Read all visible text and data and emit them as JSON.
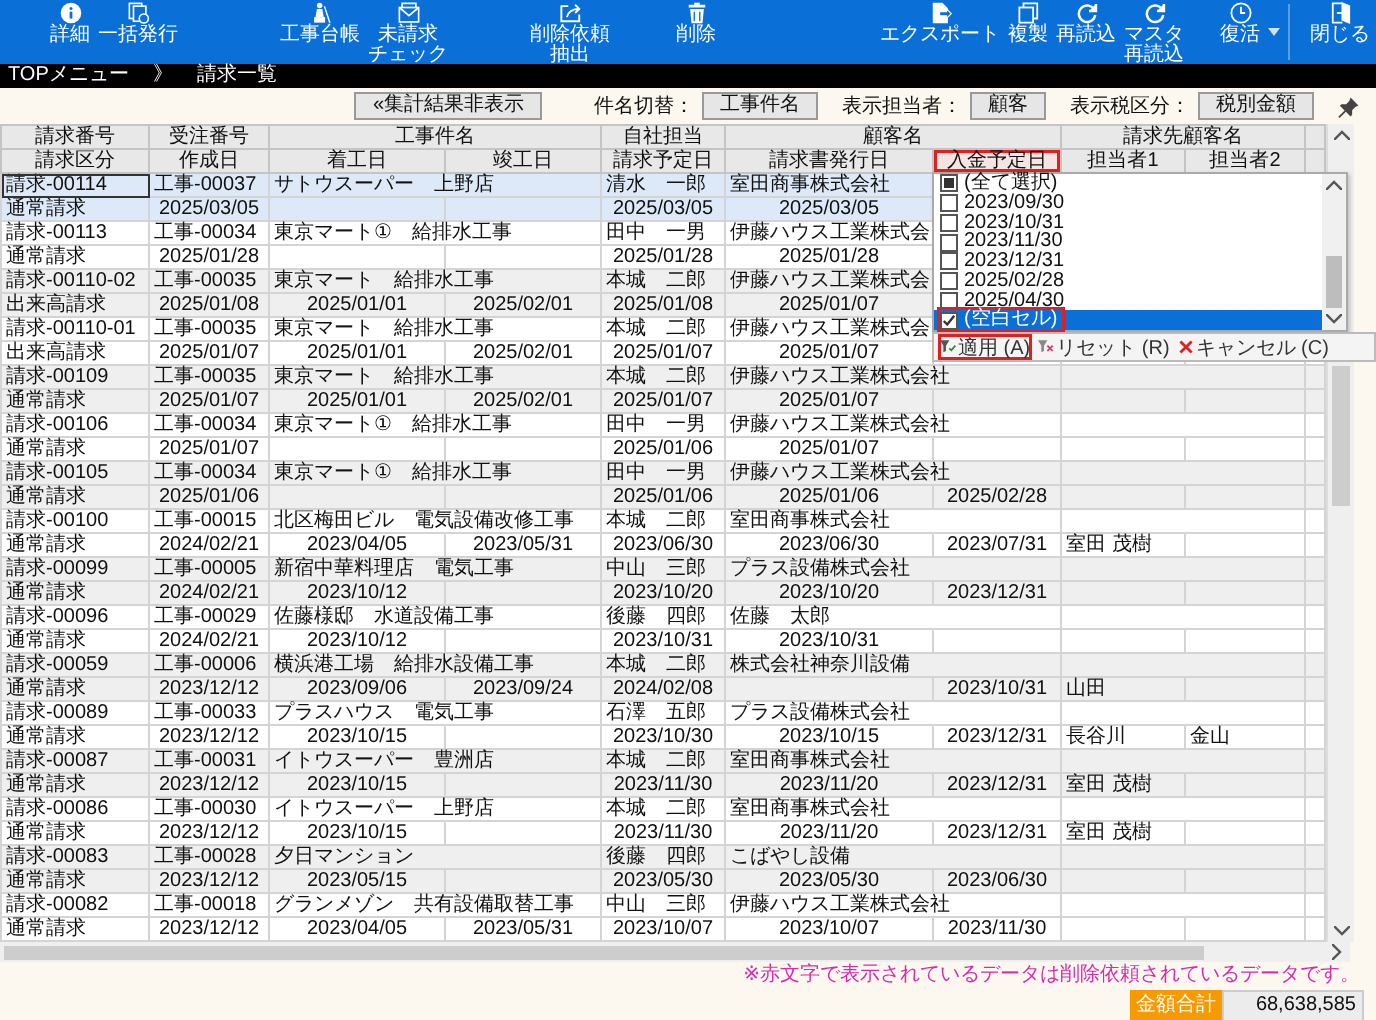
{
  "toolbar": [
    "詳細",
    "一括発行",
    "工事台帳",
    "未請求チェック",
    "削除依頼抽出",
    "削除",
    "エクスポート",
    "複製",
    "再読込",
    "マスタ再読込",
    "復活",
    "閉じる"
  ],
  "breadcrumb": {
    "parent": "TOPメニュー",
    "separator": "》",
    "current": "請求一覧"
  },
  "filter_bar": {
    "toggle_button": "«集計結果非表示",
    "switches": [
      {
        "label": "件名切替：",
        "value": "工事件名"
      },
      {
        "label": "表示担当者：",
        "value": "顧客"
      },
      {
        "label": "表示税区分：",
        "value": "税別金額"
      }
    ]
  },
  "table": {
    "header_top": [
      "請求番号",
      "受注番号",
      "工事件名",
      "自社担当",
      "顧客名",
      "請求先顧客名"
    ],
    "header_bottom": [
      {
        "label": "請求区分",
        "highlighted": false
      },
      {
        "label": "作成日",
        "highlighted": false
      },
      {
        "label": "着工日",
        "highlighted": false
      },
      {
        "label": "竣工日",
        "highlighted": false
      },
      {
        "label": "請求予定日",
        "highlighted": false
      },
      {
        "label": "請求書発行日",
        "highlighted": false
      },
      {
        "label": "入金予定日",
        "highlighted": true
      },
      {
        "label": "担当者1",
        "highlighted": false
      },
      {
        "label": "担当者2",
        "highlighted": false
      }
    ],
    "records": [
      {
        "invoice_no": "請求-00114",
        "order_no": "工事-00037",
        "project": "サトウスーパー　上野店",
        "staff": "清水　一郎",
        "customer": "室田商事株式会社",
        "invoice_type": "通常請求",
        "created": "2025/03/05",
        "bill_date": "2025/03/05",
        "issue_date": "2025/03/05",
        "selected": true
      },
      {
        "invoice_no": "請求-00113",
        "order_no": "工事-00034",
        "project": "東京マート①　給排水工事",
        "staff": "田中　一男",
        "customer": "伊藤ハウス工業株式会",
        "invoice_type": "通常請求",
        "created": "2025/01/28",
        "bill_date": "2025/01/28",
        "issue_date": "2025/01/28",
        "selected": false
      },
      {
        "invoice_no": "請求-00110-02",
        "order_no": "工事-00035",
        "project": "東京マート　給排水工事",
        "staff": "本城　二郎",
        "customer": "伊藤ハウス工業株式会",
        "invoice_type": "出来高請求",
        "created": "2025/01/08",
        "start": "2025/01/01",
        "end": "2025/02/01",
        "bill_date": "2025/01/08",
        "issue_date": "2025/01/07",
        "selected": false
      },
      {
        "invoice_no": "請求-00110-01",
        "order_no": "工事-00035",
        "project": "東京マート　給排水工事",
        "staff": "本城　二郎",
        "customer": "伊藤ハウス工業株式会",
        "invoice_type": "出来高請求",
        "created": "2025/01/07",
        "start": "2025/01/01",
        "end": "2025/02/01",
        "bill_date": "2025/01/07",
        "issue_date": "2025/01/07",
        "selected": false
      },
      {
        "invoice_no": "請求-00109",
        "order_no": "工事-00035",
        "project": "東京マート　給排水工事",
        "staff": "本城　二郎",
        "customer": "伊藤ハウス工業株式会社",
        "invoice_type": "通常請求",
        "created": "2025/01/07",
        "start": "2025/01/01",
        "end": "2025/02/01",
        "bill_date": "2025/01/07",
        "issue_date": "2025/01/07",
        "selected": false
      },
      {
        "invoice_no": "請求-00106",
        "order_no": "工事-00034",
        "project": "東京マート①　給排水工事",
        "staff": "田中　一男",
        "customer": "伊藤ハウス工業株式会社",
        "invoice_type": "通常請求",
        "created": "2025/01/07",
        "bill_date": "2025/01/06",
        "issue_date": "2025/01/07",
        "selected": false
      },
      {
        "invoice_no": "請求-00105",
        "order_no": "工事-00034",
        "project": "東京マート①　給排水工事",
        "staff": "田中　一男",
        "customer": "伊藤ハウス工業株式会社",
        "invoice_type": "通常請求",
        "created": "2025/01/06",
        "bill_date": "2025/01/06",
        "issue_date": "2025/01/06",
        "pay_date": "2025/02/28",
        "selected": false
      },
      {
        "invoice_no": "請求-00100",
        "order_no": "工事-00015",
        "project": "北区梅田ビル　電気設備改修工事",
        "staff": "本城　二郎",
        "customer": "室田商事株式会社",
        "invoice_type": "通常請求",
        "created": "2024/02/21",
        "start": "2023/04/05",
        "end": "2023/05/31",
        "bill_date": "2023/06/30",
        "issue_date": "2023/06/30",
        "pay_date": "2023/07/31",
        "person1": "室田 茂樹",
        "selected": false
      },
      {
        "invoice_no": "請求-00099",
        "order_no": "工事-00005",
        "project": "新宿中華料理店　電気工事",
        "staff": "中山　三郎",
        "customer": "プラス設備株式会社",
        "invoice_type": "通常請求",
        "created": "2024/02/21",
        "start": "2023/10/12",
        "bill_date": "2023/10/20",
        "issue_date": "2023/10/20",
        "pay_date": "2023/12/31",
        "selected": false
      },
      {
        "invoice_no": "請求-00096",
        "order_no": "工事-00029",
        "project": "佐藤様邸　水道設備工事",
        "staff": "後藤　四郎",
        "customer": "佐藤　太郎",
        "invoice_type": "通常請求",
        "created": "2024/02/21",
        "start": "2023/10/12",
        "bill_date": "2023/10/31",
        "issue_date": "2023/10/31",
        "selected": false
      },
      {
        "invoice_no": "請求-00059",
        "order_no": "工事-00006",
        "project": "横浜港工場　給排水設備工事",
        "staff": "本城　二郎",
        "customer": "株式会社神奈川設備",
        "invoice_type": "通常請求",
        "created": "2023/12/12",
        "start": "2023/09/06",
        "end": "2023/09/24",
        "bill_date": "2024/02/08",
        "pay_date": "2023/10/31",
        "person1": "山田",
        "selected": false
      },
      {
        "invoice_no": "請求-00089",
        "order_no": "工事-00033",
        "project": "プラスハウス　電気工事",
        "staff": "石澤　五郎",
        "customer": "プラス設備株式会社",
        "invoice_type": "通常請求",
        "created": "2023/12/12",
        "start": "2023/10/15",
        "bill_date": "2023/10/30",
        "issue_date": "2023/10/15",
        "pay_date": "2023/12/31",
        "person1": "長谷川",
        "person2": "金山",
        "selected": false
      },
      {
        "invoice_no": "請求-00087",
        "order_no": "工事-00031",
        "project": "イトウスーパー　豊洲店",
        "staff": "本城　二郎",
        "customer": "室田商事株式会社",
        "invoice_type": "通常請求",
        "created": "2023/12/12",
        "start": "2023/10/15",
        "bill_date": "2023/11/30",
        "issue_date": "2023/11/20",
        "pay_date": "2023/12/31",
        "person1": "室田 茂樹",
        "selected": false
      },
      {
        "invoice_no": "請求-00086",
        "order_no": "工事-00030",
        "project": "イトウスーパー　上野店",
        "staff": "本城　二郎",
        "customer": "室田商事株式会社",
        "invoice_type": "通常請求",
        "created": "2023/12/12",
        "start": "2023/10/15",
        "bill_date": "2023/11/30",
        "issue_date": "2023/11/20",
        "pay_date": "2023/12/31",
        "person1": "室田 茂樹",
        "selected": false
      },
      {
        "invoice_no": "請求-00083",
        "order_no": "工事-00028",
        "project": "夕日マンション",
        "staff": "後藤　四郎",
        "customer": "こばやし設備",
        "invoice_type": "通常請求",
        "created": "2023/12/12",
        "start": "2023/05/15",
        "bill_date": "2023/05/30",
        "issue_date": "2023/05/30",
        "pay_date": "2023/06/30",
        "selected": false
      },
      {
        "invoice_no": "請求-00082",
        "order_no": "工事-00018",
        "project": "グランメゾン　共有設備取替工事",
        "staff": "中山　三郎",
        "customer": "伊藤ハウス工業株式会社",
        "invoice_type": "通常請求",
        "created": "2023/12/12",
        "start": "2023/04/05",
        "end": "2023/05/31",
        "bill_date": "2023/10/07",
        "issue_date": "2023/10/07",
        "pay_date": "2023/11/30",
        "selected": false
      }
    ]
  },
  "filter_popup": {
    "items": [
      {
        "label": "(全て選択)",
        "checked": false,
        "partial": true,
        "selected": false,
        "highlighted": false
      },
      {
        "label": "2023/09/30",
        "checked": false,
        "partial": false,
        "selected": false,
        "highlighted": false
      },
      {
        "label": "2023/10/31",
        "checked": false,
        "partial": false,
        "selected": false,
        "highlighted": false
      },
      {
        "label": "2023/11/30",
        "checked": false,
        "partial": false,
        "selected": false,
        "highlighted": false
      },
      {
        "label": "2023/12/31",
        "checked": false,
        "partial": false,
        "selected": false,
        "highlighted": false
      },
      {
        "label": "2025/02/28",
        "checked": false,
        "partial": false,
        "selected": false,
        "highlighted": false
      },
      {
        "label": "2025/04/30",
        "checked": false,
        "partial": false,
        "selected": false,
        "highlighted": false
      },
      {
        "label": "(空白セル)",
        "checked": true,
        "partial": false,
        "selected": true,
        "highlighted": true
      }
    ],
    "buttons": [
      {
        "kind": "apply",
        "label": "適用 (A)",
        "highlighted": true
      },
      {
        "kind": "reset",
        "label": "リセット (R)",
        "highlighted": false
      },
      {
        "kind": "cancel",
        "label": "キャンセル (C)",
        "highlighted": false
      }
    ]
  },
  "note": "※赤文字で表示されているデータは削除依頼されているデータです。",
  "total": {
    "label": "金額合計",
    "value": "68,638,585"
  }
}
